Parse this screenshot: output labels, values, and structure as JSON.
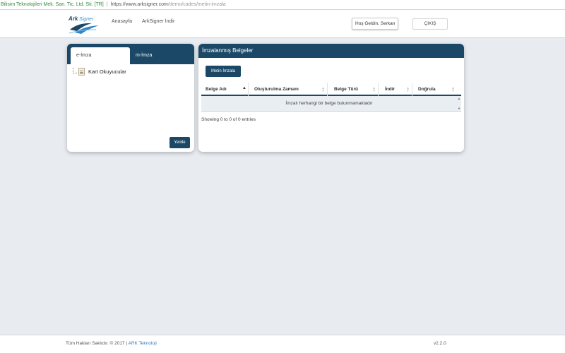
{
  "browser": {
    "cert_label": "Bilisim Teknolojileri Mek. San. Tic. Ltd. Sti. [TR]",
    "url_host": "https://www.arksigner.com",
    "url_path": "/demo/cades/metin-imzala"
  },
  "header": {
    "logo_text": "ArkSigner",
    "nav": [
      {
        "label": "Anasayfa"
      },
      {
        "label": "ArkSigner İndir"
      }
    ],
    "welcome": "Hoş Geldin, Serkan",
    "logout": "ÇIKIŞ"
  },
  "left_panel": {
    "tabs": [
      {
        "label": "e-İmza",
        "active": true
      },
      {
        "label": "m-İmza",
        "active": false
      }
    ],
    "tree": [
      {
        "label": "Kart Okuyucular",
        "icon": "card-reader-icon"
      }
    ],
    "refresh_button": "Yenile"
  },
  "right_panel": {
    "title": "İmzalanmış Belgeler",
    "sign_button": "Metin İmzala",
    "table": {
      "columns": [
        {
          "label": "Belge Adı",
          "sort": "asc"
        },
        {
          "label": "Oluşturulma Zamanı",
          "sort": "both"
        },
        {
          "label": "Belge Türü",
          "sort": "both"
        },
        {
          "label": "İndir",
          "sort": "both"
        },
        {
          "label": "Doğrula",
          "sort": "both"
        }
      ],
      "empty_message": "İmzalı herhangi bir belge bulunmamaktadır",
      "info": "Showing 0 to 0 of 0 entries"
    }
  },
  "footer": {
    "copyright": "Tüm Hakları Saklıdır. © 2017 |",
    "company_link": "ARK Teknoloji",
    "version": "v2.2.0"
  },
  "colors": {
    "primary": "#1b4866",
    "background": "#e8ecf1",
    "link": "#3a7bbf",
    "cert_green": "#2e8b3a"
  }
}
